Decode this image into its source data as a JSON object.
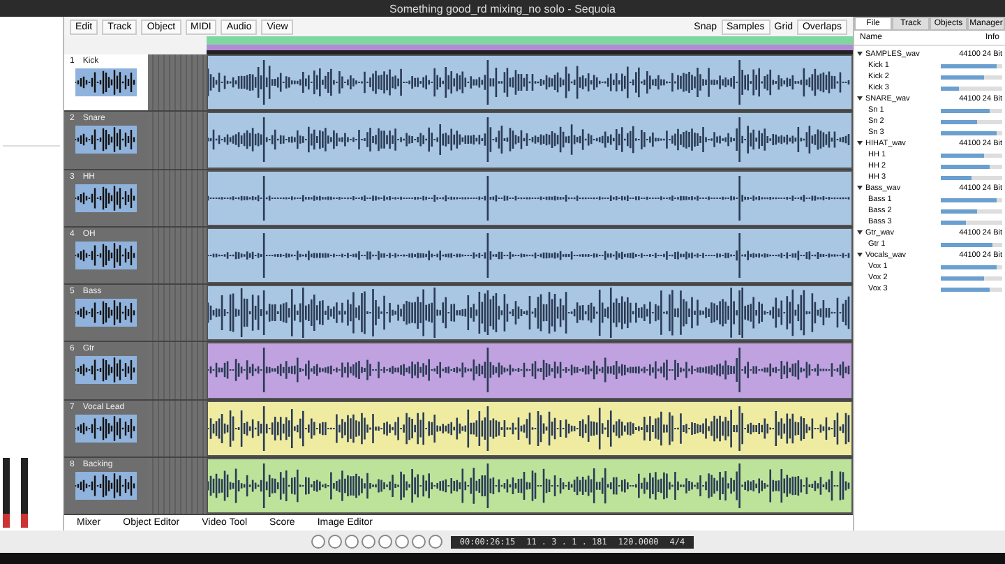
{
  "window": {
    "title": "Something good_rd mixing_no solo - Sequoia"
  },
  "menu": [
    {
      "label": "Edit"
    },
    {
      "label": "Track"
    },
    {
      "label": "Object"
    },
    {
      "label": "MIDI"
    },
    {
      "label": "Audio"
    },
    {
      "label": "View"
    }
  ],
  "toolbar": {
    "snap_label": "Snap",
    "snap_value": "Samples",
    "grid_label": "Grid",
    "grid_value": "Overlaps"
  },
  "tracks": [
    {
      "number": "1",
      "name": "Kick",
      "color": "#a9c6e3",
      "selected": true
    },
    {
      "number": "2",
      "name": "Snare",
      "color": "#a9c6e3",
      "selected": false
    },
    {
      "number": "3",
      "name": "HH",
      "color": "#a9c6e3",
      "selected": false
    },
    {
      "number": "4",
      "name": "OH",
      "color": "#a9c6e3",
      "selected": false
    },
    {
      "number": "5",
      "name": "Bass",
      "color": "#a9c6e3",
      "selected": false
    },
    {
      "number": "6",
      "name": "Gtr",
      "color": "#c0a2e0",
      "selected": false
    },
    {
      "number": "7",
      "name": "Vocal Lead",
      "color": "#efeca2",
      "selected": false
    },
    {
      "number": "8",
      "name": "Backing",
      "color": "#bde39a",
      "selected": false
    }
  ],
  "right_panel": {
    "tabs": [
      {
        "label": "File",
        "selected": true
      },
      {
        "label": "Track",
        "selected": false
      },
      {
        "label": "Objects",
        "selected": false
      },
      {
        "label": "Manager",
        "selected": false
      }
    ],
    "columns": [
      "Name",
      "Info"
    ],
    "items": [
      {
        "name": "SAMPLES_wav",
        "info": "44100 24 Bit",
        "children": [
          {
            "name": "Kick 1",
            "level": 0.9
          },
          {
            "name": "Kick 2",
            "level": 0.7
          },
          {
            "name": "Kick 3",
            "level": 0.3
          }
        ]
      },
      {
        "name": "SNARE_wav",
        "info": "44100 24 Bit",
        "children": [
          {
            "name": "Sn 1",
            "level": 0.8
          },
          {
            "name": "Sn 2",
            "level": 0.6
          },
          {
            "name": "Sn 3",
            "level": 0.9
          }
        ]
      },
      {
        "name": "HIHAT_wav",
        "info": "44100 24 Bit",
        "children": [
          {
            "name": "HH 1",
            "level": 0.7
          },
          {
            "name": "HH 2",
            "level": 0.8
          },
          {
            "name": "HH 3",
            "level": 0.5
          }
        ]
      },
      {
        "name": "Bass_wav",
        "info": "44100 24 Bit",
        "children": [
          {
            "name": "Bass 1",
            "level": 0.9
          },
          {
            "name": "Bass 2",
            "level": 0.6
          },
          {
            "name": "Bass 3",
            "level": 0.4
          }
        ]
      },
      {
        "name": "Gtr_wav",
        "info": "44100 24 Bit",
        "children": [
          {
            "name": "Gtr 1",
            "level": 0.85
          }
        ]
      },
      {
        "name": "Vocals_wav",
        "info": "44100 24 Bit",
        "children": [
          {
            "name": "Vox 1",
            "level": 0.9
          },
          {
            "name": "Vox 2",
            "level": 0.7
          },
          {
            "name": "Vox 3",
            "level": 0.8
          }
        ]
      }
    ]
  },
  "bottom_tabs": [
    {
      "label": "Mixer"
    },
    {
      "label": "Object Editor"
    },
    {
      "label": "Video Tool"
    },
    {
      "label": "Score"
    },
    {
      "label": "Image Editor"
    }
  ],
  "transport": {
    "time": "00:00:26:15",
    "position": "11 . 3 . 1 . 181",
    "tempo": "120.0000",
    "signature": "4/4"
  }
}
